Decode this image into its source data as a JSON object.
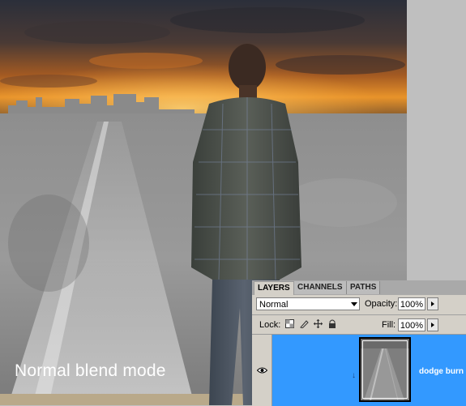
{
  "caption": "Normal blend mode",
  "layers_panel": {
    "tabs": [
      "LAYERS",
      "CHANNELS",
      "PATHS"
    ],
    "active_tab": "LAYERS",
    "blend_mode": "Normal",
    "opacity_label": "Opacity:",
    "opacity_value": "100%",
    "lock_label": "Lock:",
    "lock_icons": [
      "lock-transparent-pixels-icon",
      "lock-image-pixels-icon",
      "lock-position-icon",
      "lock-all-icon"
    ],
    "fill_label": "Fill:",
    "fill_value": "100%",
    "layers": [
      {
        "name": "dodge burn",
        "visible": true,
        "selected": true
      }
    ]
  },
  "colors": {
    "selected_layer": "#3399ff",
    "panel_bg": "#d4d0c8",
    "canvas_bg": "#bfbfbf"
  }
}
